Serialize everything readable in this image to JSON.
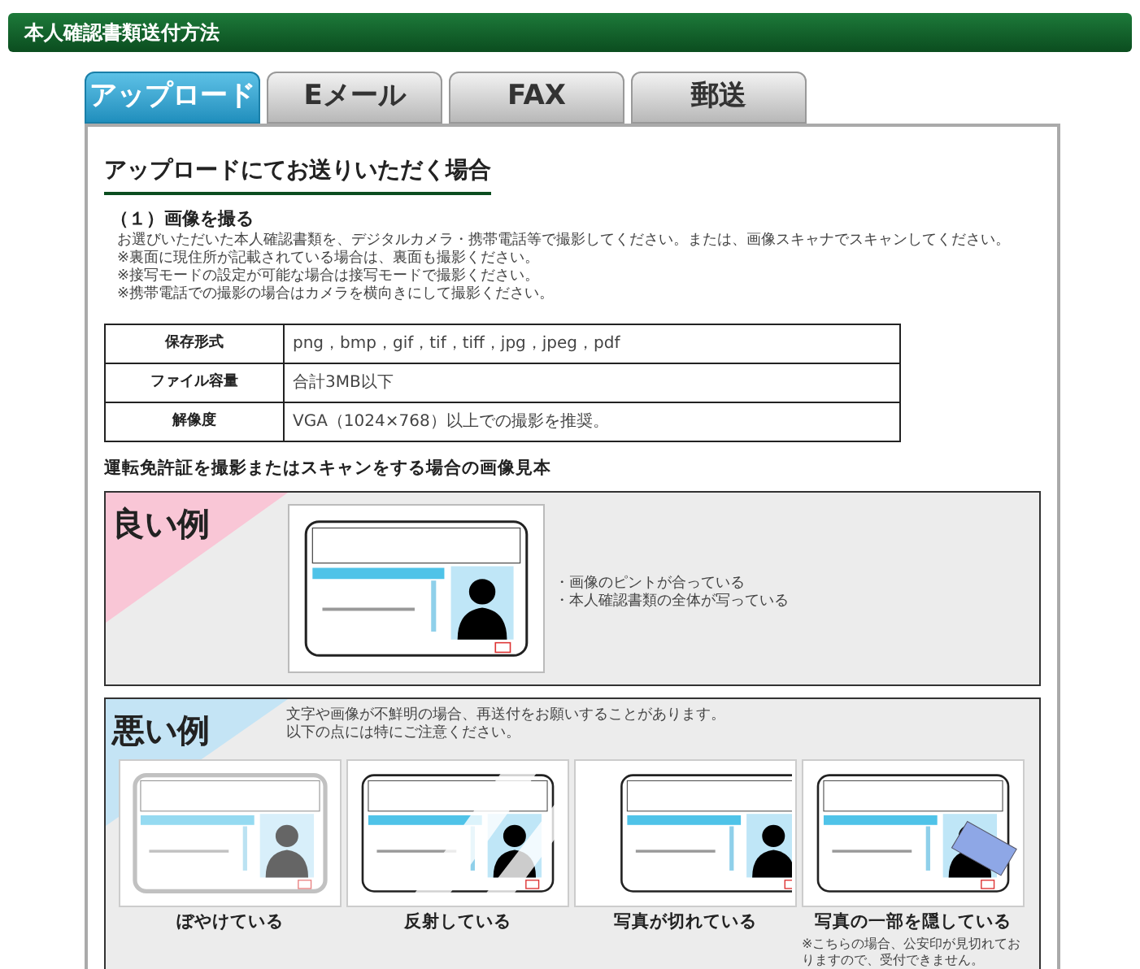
{
  "header": {
    "title": "本人確認書類送付方法"
  },
  "tabs": [
    {
      "label": "アップロード",
      "selected": true
    },
    {
      "label": "Eメール",
      "selected": false
    },
    {
      "label": "FAX",
      "selected": false
    },
    {
      "label": "郵送",
      "selected": false
    }
  ],
  "heading": "アップロードにてお送りいただく場合",
  "section": {
    "title": "（１）画像を撮る",
    "lines": [
      "お選びいただいた本人確認書類を、デジタルカメラ・携帯電話等で撮影してください。または、画像スキャナでスキャンしてください。",
      "※裏面に現住所が記載されている場合は、裏面も撮影ください。",
      "※接写モードの設定が可能な場合は接写モードで撮影ください。",
      "※携帯電話での撮影の場合はカメラを横向きにして撮影ください。"
    ]
  },
  "table": {
    "rows": [
      {
        "label": "保存形式",
        "value": "png，bmp，gif，tif，tiff，jpg，jpeg，pdf"
      },
      {
        "label": "ファイル容量",
        "value": "合計3MB以下"
      },
      {
        "label": "解像度",
        "value": "VGA（1024×768）以上での撮影を推奨。"
      }
    ]
  },
  "samples_title": "運転免許証を撮影またはスキャンをする場合の画像見本",
  "good": {
    "title": "良い例",
    "points": [
      "・画像のピントが合っている",
      "・本人確認書類の全体が写っている"
    ]
  },
  "bad": {
    "title": "悪い例",
    "lines": [
      "文字や画像が不鮮明の場合、再送付をお願いすることがあります。",
      "以下の点には特にご注意ください。"
    ],
    "examples": [
      {
        "caption": "ぼやけている"
      },
      {
        "caption": "反射している"
      },
      {
        "caption": "写真が切れている"
      },
      {
        "caption": "写真の一部を隠している",
        "note": "※こちらの場合、公安印が見切れておりますので、受付できません。"
      }
    ]
  }
}
